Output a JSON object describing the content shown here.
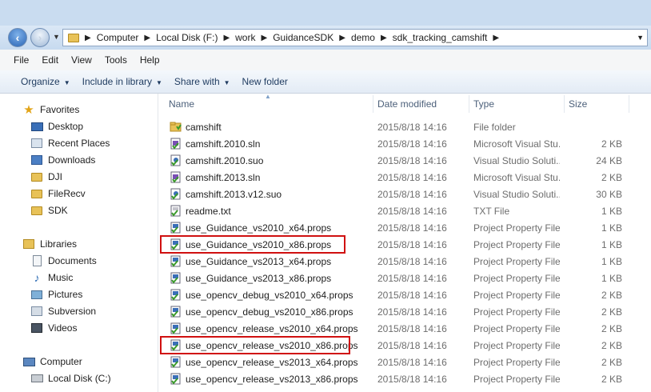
{
  "address": {
    "crumbs": [
      "Computer",
      "Local Disk (F:)",
      "work",
      "GuidanceSDK",
      "demo",
      "sdk_tracking_camshift"
    ]
  },
  "menu": [
    "File",
    "Edit",
    "View",
    "Tools",
    "Help"
  ],
  "commands": [
    {
      "label": "Organize",
      "dropdown": true
    },
    {
      "label": "Include in library",
      "dropdown": true
    },
    {
      "label": "Share with",
      "dropdown": true
    },
    {
      "label": "New folder",
      "dropdown": false
    }
  ],
  "nav": {
    "favorites": {
      "label": "Favorites",
      "items": [
        "Desktop",
        "Recent Places",
        "Downloads",
        "DJI",
        "FileRecv",
        "SDK"
      ]
    },
    "libraries": {
      "label": "Libraries",
      "items": [
        "Documents",
        "Music",
        "Pictures",
        "Subversion",
        "Videos"
      ]
    },
    "computer": {
      "label": "Computer",
      "items": [
        "Local Disk (C:)"
      ]
    }
  },
  "columns": {
    "name": "Name",
    "date": "Date modified",
    "type": "Type",
    "size": "Size"
  },
  "files": [
    {
      "name": "camshift",
      "date": "2015/8/18 14:16",
      "type": "File folder",
      "size": "",
      "icon": "folder-icon"
    },
    {
      "name": "camshift.2010.sln",
      "date": "2015/8/18 14:16",
      "type": "Microsoft Visual Stu...",
      "size": "2 KB",
      "icon": "sln-icon"
    },
    {
      "name": "camshift.2010.suo",
      "date": "2015/8/18 14:16",
      "type": "Visual Studio Soluti...",
      "size": "24 KB",
      "icon": "suo-icon"
    },
    {
      "name": "camshift.2013.sln",
      "date": "2015/8/18 14:16",
      "type": "Microsoft Visual Stu...",
      "size": "2 KB",
      "icon": "sln-icon"
    },
    {
      "name": "camshift.2013.v12.suo",
      "date": "2015/8/18 14:16",
      "type": "Visual Studio Soluti...",
      "size": "30 KB",
      "icon": "suo-icon"
    },
    {
      "name": "readme.txt",
      "date": "2015/8/18 14:16",
      "type": "TXT File",
      "size": "1 KB",
      "icon": "txt-icon"
    },
    {
      "name": "use_Guidance_vs2010_x64.props",
      "date": "2015/8/18 14:16",
      "type": "Project Property File",
      "size": "1 KB",
      "icon": "props-icon"
    },
    {
      "name": "use_Guidance_vs2010_x86.props",
      "date": "2015/8/18 14:16",
      "type": "Project Property File",
      "size": "1 KB",
      "icon": "props-icon",
      "highlighted": true
    },
    {
      "name": "use_Guidance_vs2013_x64.props",
      "date": "2015/8/18 14:16",
      "type": "Project Property File",
      "size": "1 KB",
      "icon": "props-icon"
    },
    {
      "name": "use_Guidance_vs2013_x86.props",
      "date": "2015/8/18 14:16",
      "type": "Project Property File",
      "size": "1 KB",
      "icon": "props-icon"
    },
    {
      "name": "use_opencv_debug_vs2010_x64.props",
      "date": "2015/8/18 14:16",
      "type": "Project Property File",
      "size": "2 KB",
      "icon": "props-icon"
    },
    {
      "name": "use_opencv_debug_vs2010_x86.props",
      "date": "2015/8/18 14:16",
      "type": "Project Property File",
      "size": "2 KB",
      "icon": "props-icon"
    },
    {
      "name": "use_opencv_release_vs2010_x64.props",
      "date": "2015/8/18 14:16",
      "type": "Project Property File",
      "size": "2 KB",
      "icon": "props-icon"
    },
    {
      "name": "use_opencv_release_vs2010_x86.props",
      "date": "2015/8/18 14:16",
      "type": "Project Property File",
      "size": "2 KB",
      "icon": "props-icon",
      "highlighted": true
    },
    {
      "name": "use_opencv_release_vs2013_x64.props",
      "date": "2015/8/18 14:16",
      "type": "Project Property File",
      "size": "2 KB",
      "icon": "props-icon"
    },
    {
      "name": "use_opencv_release_vs2013_x86.props",
      "date": "2015/8/18 14:16",
      "type": "Project Property File",
      "size": "2 KB",
      "icon": "props-icon"
    }
  ],
  "highlight_color": "#d01010"
}
